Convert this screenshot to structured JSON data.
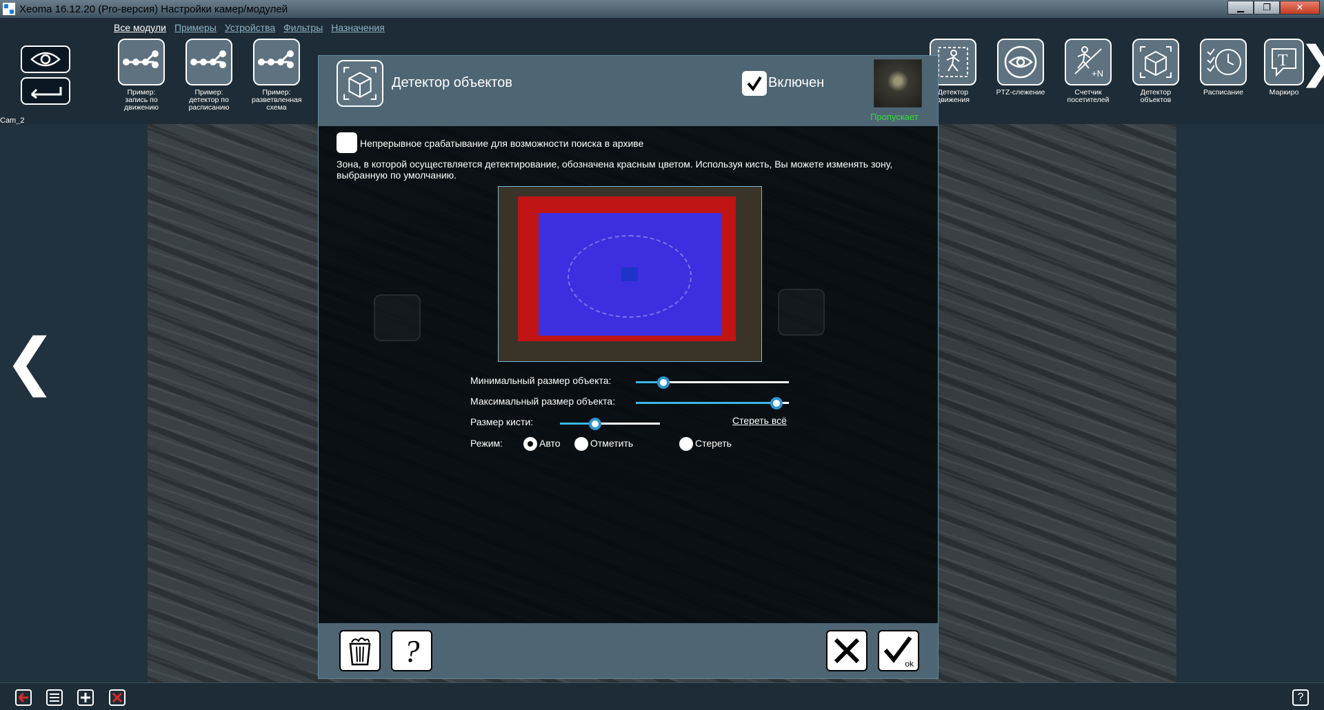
{
  "window": {
    "title": "Xeoma 16.12.20 (Pro-версия) Настройки камер/модулей",
    "buttons": {
      "minimize": "▁",
      "maximize": "❐",
      "close": "✕"
    }
  },
  "menu": {
    "items": [
      "Все модули",
      "Примеры",
      "Устройства",
      "Фильтры",
      "Назначения"
    ]
  },
  "left_panel": {
    "camera_label": "Cam_2"
  },
  "modules": [
    {
      "label": "Пример: запись по движению",
      "icon": "workflow-icon"
    },
    {
      "label": "Пример: детектор по расписанию",
      "icon": "workflow-icon"
    },
    {
      "label": "Пример: разветвленная схема",
      "icon": "workflow-icon"
    },
    {
      "label": "Детектор движения",
      "icon": "motion-detector-icon"
    },
    {
      "label": "PTZ-слежение",
      "icon": "ptz-tracking-icon"
    },
    {
      "label": "Счетчик посетителей",
      "icon": "visitor-counter-icon"
    },
    {
      "label": "Детектор объектов",
      "icon": "object-detector-icon"
    },
    {
      "label": "Расписание",
      "icon": "schedule-icon"
    },
    {
      "label": "Маркиро",
      "icon": "marking-icon"
    }
  ],
  "dialog": {
    "title": "Детектор объектов",
    "enabled_label": "Включен",
    "enabled": true,
    "status": "Пропускает",
    "continuous_label": "Непрерывное срабатывание для возможности поиска в архиве",
    "continuous_checked": false,
    "zone_description": "Зона, в которой осуществляется детектирование, обозначена красным цветом. Используя кисть, Вы можете изменять зону, выбранную по умолчанию.",
    "min_size_label": "Минимальный размер объекта:",
    "min_size_value": 0.18,
    "max_size_label": "Максимальный размер объекта:",
    "max_size_value": 0.92,
    "brush_size_label": "Размер кисти:",
    "brush_size_value": 0.35,
    "clear_all_label": "Стереть всё",
    "mode_label": "Режим:",
    "modes": [
      {
        "label": "Авто",
        "checked": true
      },
      {
        "label": "Отметить",
        "checked": false
      },
      {
        "label": "Стереть",
        "checked": false
      }
    ],
    "footer": {
      "delete_icon": "trash-icon",
      "help_label": "?",
      "cancel_icon": "close-icon",
      "ok_label": "ok"
    }
  },
  "bottom_bar": {
    "help_label": "?"
  },
  "colors": {
    "accent": "#2e95cf",
    "status_green": "#2ee02e",
    "zone_red": "#c01414",
    "zone_blue": "#3d2ee0",
    "panel": "#4e6573"
  }
}
